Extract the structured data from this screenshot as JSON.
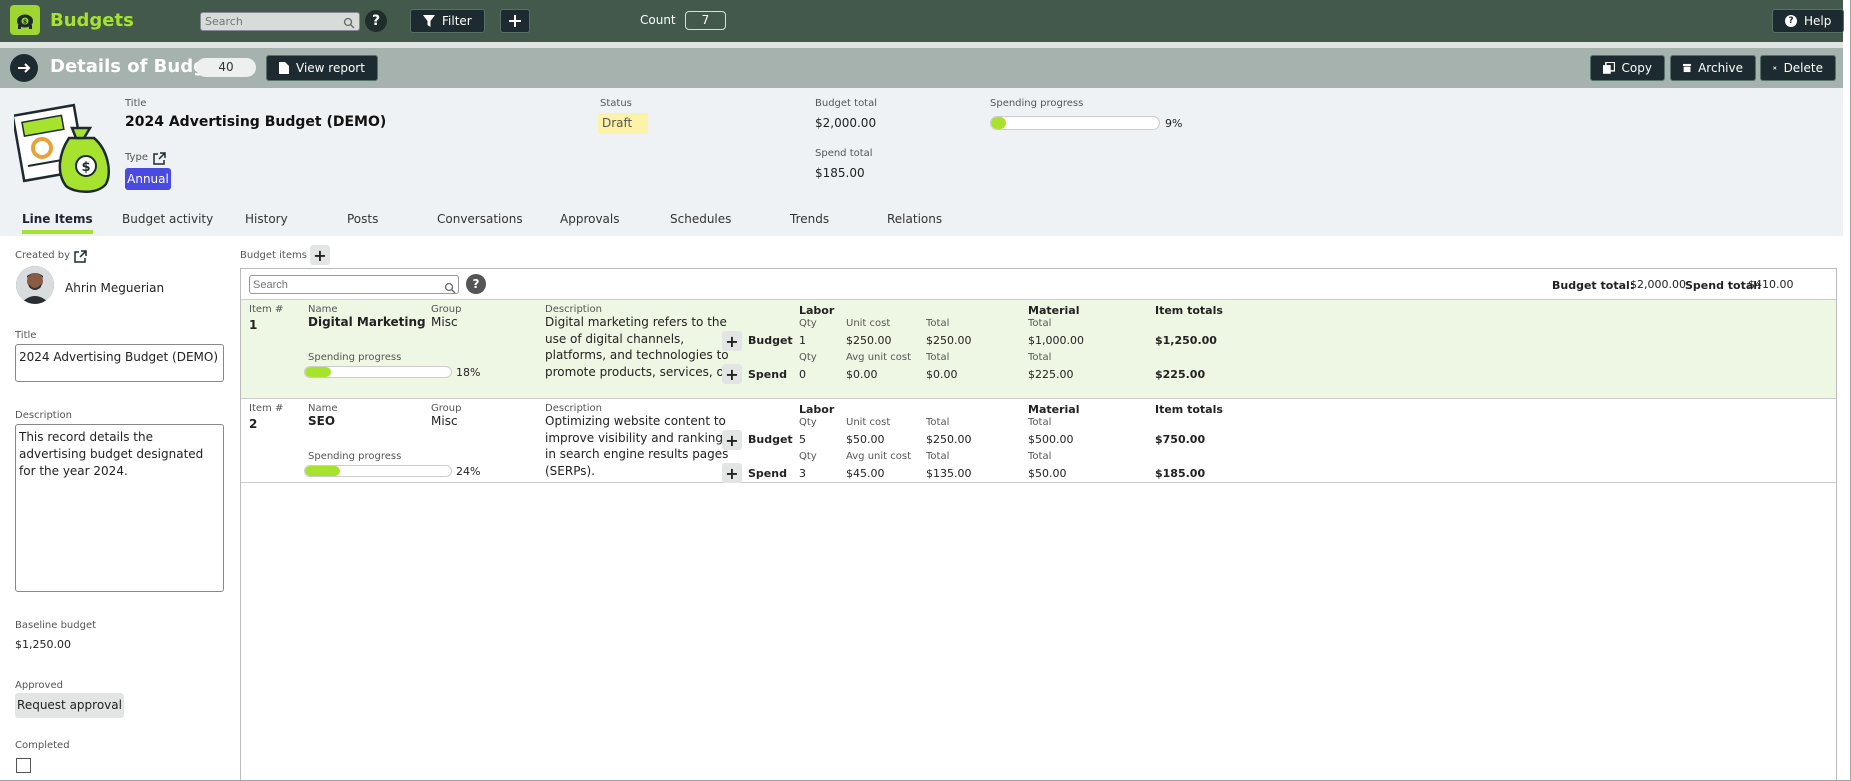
{
  "app": {
    "name": "Budgets",
    "logo_icon": "piggy-bank-icon",
    "accent": "#a6e22e",
    "topbar_color": "#43594c"
  },
  "topbar": {
    "search_placeholder": "Search",
    "filter_label": "Filter",
    "count_label": "Count",
    "count_value": "7",
    "help_label": "Help"
  },
  "details": {
    "heading": "Details of Budget",
    "record_number": "40",
    "view_report_label": "View report",
    "copy_label": "Copy",
    "archive_label": "Archive",
    "delete_label": "Delete"
  },
  "summary": {
    "title_label": "Title",
    "title": "2024 Advertising Budget (DEMO)",
    "type_label": "Type",
    "type_value": "Annual",
    "status_label": "Status",
    "status_value": "Draft",
    "budget_total_label": "Budget total",
    "budget_total": "$2,000.00",
    "spend_total_label": "Spend total",
    "spend_total": "$185.00",
    "progress_label": "Spending progress",
    "progress_text": "9%",
    "progress_value": 9
  },
  "tabs": [
    "Line Items",
    "Budget activity",
    "History",
    "Posts",
    "Conversations",
    "Approvals",
    "Schedules",
    "Trends",
    "Relations"
  ],
  "sidebar": {
    "created_by_label": "Created by",
    "creator": "Ahrin Meguerian",
    "title_label": "Title",
    "title_value": "2024 Advertising Budget (DEMO)",
    "description_label": "Description",
    "description_value": "This record details the advertising budget designated for the year 2024.",
    "baseline_label": "Baseline budget",
    "baseline_value": "$1,250.00",
    "approved_label": "Approved",
    "request_approval_label": "Request approval",
    "completed_label": "Completed"
  },
  "items_panel": {
    "label": "Budget items",
    "search_placeholder": "Search",
    "budget_total_label": "Budget total:",
    "budget_total": "$2,000.00",
    "spend_total_label": "Spend total:",
    "spend_total": "$410.00"
  },
  "cols": {
    "item": "Item #",
    "name": "Name",
    "group": "Group",
    "progress": "Spending progress",
    "description": "Description",
    "labor": "Labor",
    "material": "Material",
    "item_totals": "Item totals",
    "qty": "Qty",
    "unit_cost": "Unit cost",
    "avg_unit_cost": "Avg unit cost",
    "total": "Total",
    "budget": "Budget",
    "spend": "Spend"
  },
  "items": [
    {
      "num": "1",
      "name": "Digital Marketing",
      "group": "Misc",
      "progress_text": "18%",
      "progress_value": 18,
      "description": "Digital marketing refers to the use of digital channels, platforms, and technologies to promote products, services, or brands to reach and engage with potential",
      "budget": {
        "qty": "1",
        "unit_cost": "$250.00",
        "labor_total": "$250.00",
        "material_total": "$1,000.00",
        "item_total": "$1,250.00"
      },
      "spend": {
        "qty": "0",
        "unit_cost": "$0.00",
        "labor_total": "$0.00",
        "material_total": "$225.00",
        "item_total": "$225.00"
      }
    },
    {
      "num": "2",
      "name": "SEO",
      "group": "Misc",
      "progress_text": "24%",
      "progress_value": 24,
      "description": "Optimizing website content to improve visibility and ranking in search engine results pages (SERPs).",
      "budget": {
        "qty": "5",
        "unit_cost": "$50.00",
        "labor_total": "$250.00",
        "material_total": "$500.00",
        "item_total": "$750.00"
      },
      "spend": {
        "qty": "3",
        "unit_cost": "$45.00",
        "labor_total": "$135.00",
        "material_total": "$50.00",
        "item_total": "$185.00"
      }
    }
  ]
}
